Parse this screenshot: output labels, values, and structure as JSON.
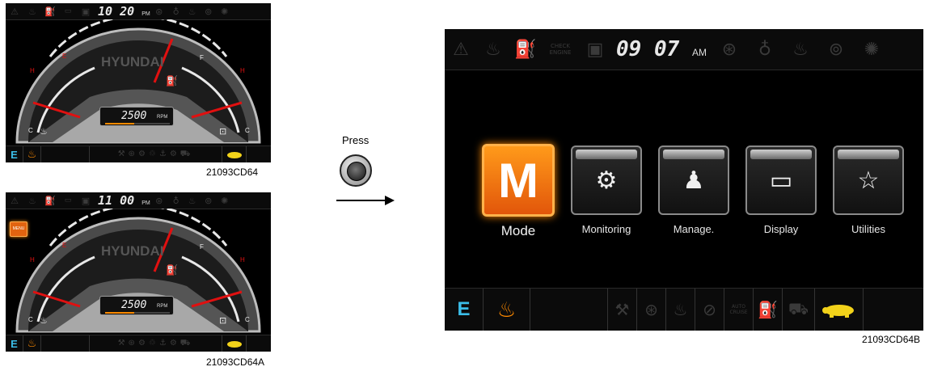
{
  "top_left_panel": {
    "clock_time": "10 20",
    "clock_ampm": "PM",
    "rpm": "2500",
    "rpm_unit": "RPM",
    "brand": "HYUNDAI",
    "gauge_letters": [
      "H",
      "E",
      "F",
      "H",
      "C",
      "C"
    ],
    "eco_label": "E",
    "caption": "21093CD64"
  },
  "bottom_left_panel": {
    "clock_time": "11 00",
    "clock_ampm": "PM",
    "menu_badge": "MENU",
    "rpm": "2500",
    "rpm_unit": "RPM",
    "brand": "HYUNDAI",
    "gauge_letters": [
      "H",
      "E",
      "F",
      "H",
      "C",
      "C"
    ],
    "eco_label": "E",
    "caption": "21093CD64A"
  },
  "instruction": {
    "press_label": "Press"
  },
  "main_panel": {
    "clock_time": "09 07",
    "clock_ampm": "AM",
    "check_engine": "CHECK ENGINE",
    "auto_cruise": "AUTO CRUISE",
    "eco_label": "E",
    "menu_items": [
      {
        "label": "Mode",
        "icon": "M",
        "selected": true
      },
      {
        "label": "Monitoring",
        "icon": "gear-icon",
        "selected": false
      },
      {
        "label": "Manage.",
        "icon": "person-icon",
        "selected": false
      },
      {
        "label": "Display",
        "icon": "tv-icon",
        "selected": false
      },
      {
        "label": "Utilities",
        "icon": "star-icon",
        "selected": false
      }
    ],
    "caption": "21093CD64B"
  },
  "colors": {
    "accent_orange": "#ff8a00",
    "needle_red": "#e01010",
    "eco_blue": "#3bbde8",
    "turtle_yellow": "#f2d21a"
  }
}
